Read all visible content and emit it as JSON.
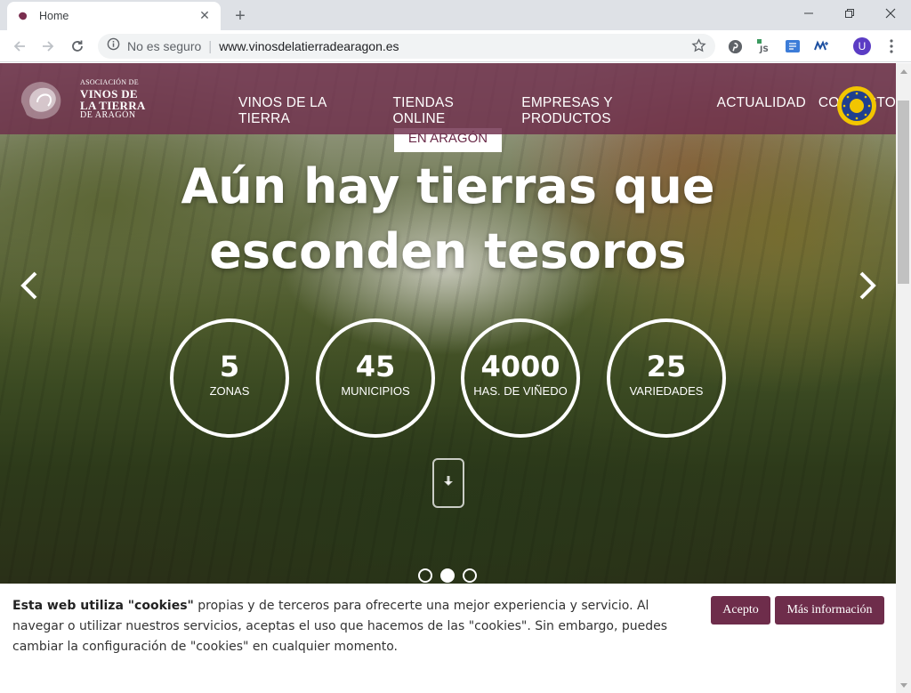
{
  "browser": {
    "tab_title": "Home",
    "tab_close": "✕",
    "newtab": "+",
    "security_label": "No es seguro",
    "url": "www.vinosdelatierradearagon.es",
    "profile_initial": "U",
    "ext_js_label": "JS"
  },
  "site": {
    "logo": {
      "line1": "ASOCIACIÓN DE",
      "line2": "VINOS DE",
      "line3": "LA TIERRA",
      "line4": "DE ARAGÓN"
    },
    "nav": [
      "VINOS DE LA TIERRA",
      "TIENDAS ONLINE",
      "EMPRESAS Y PRODUCTOS",
      "ACTUALIDAD",
      "CONTACTO"
    ],
    "hero": {
      "kicker": "EN ARAGÓN",
      "headline_line1": "Aún hay tierras que",
      "headline_line2": "esconden tesoros",
      "stats": [
        {
          "value": "5",
          "label": "ZONAS"
        },
        {
          "value": "45",
          "label": "MUNICIPIOS"
        },
        {
          "value": "4000",
          "label": "HAS. DE VIÑEDO"
        },
        {
          "value": "25",
          "label": "VARIEDADES"
        }
      ],
      "slides_total": 3,
      "active_slide": 2
    },
    "cookie": {
      "bold": "Esta web utiliza \"cookies\"",
      "text": " propias y de terceros para ofrecerte una mejor experiencia y servicio. Al navegar o utilizar nuestros servicios, aceptas el uso que hacemos de las \"cookies\". Sin embargo, puedes cambiar la configuración de \"cookies\" en cualquier momento.",
      "accept": "Acepto",
      "more": "Más información"
    }
  },
  "colors": {
    "brand": "#6e2d4b",
    "header": "#6e2d4b"
  },
  "icons": {
    "back": "arrow-left-icon",
    "forward": "arrow-right-icon",
    "reload": "reload-icon",
    "info": "info-icon",
    "bookmark": "star-icon"
  }
}
